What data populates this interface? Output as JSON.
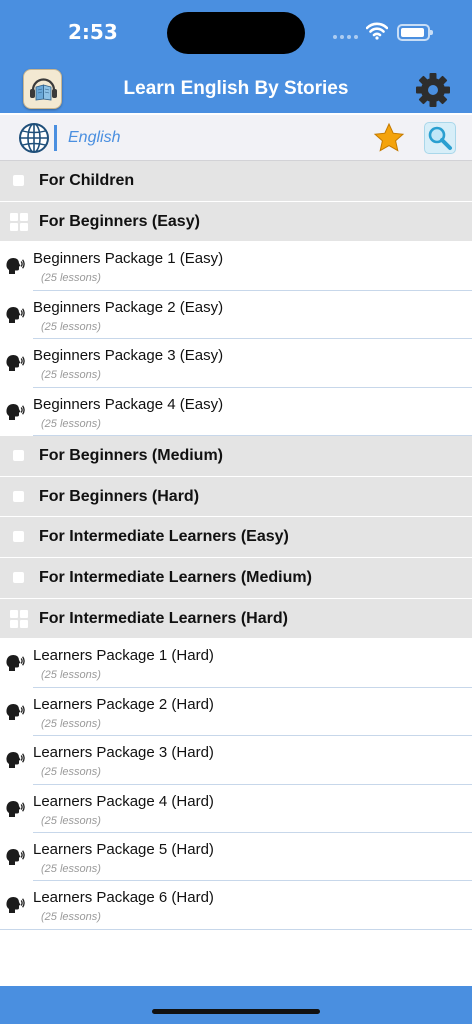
{
  "status": {
    "time": "2:53"
  },
  "header": {
    "title": "Learn English By Stories",
    "logo_icon": "book-headphones-icon",
    "settings_icon": "gear-icon"
  },
  "toolbar": {
    "language": "English",
    "globe_icon": "globe-icon",
    "favorites_icon": "star-icon",
    "search_icon": "search-icon"
  },
  "colors": {
    "accent": "#4a8fe0",
    "section_bg": "#e4e4e4",
    "star": "#f4a30c"
  },
  "sections": [
    {
      "label": "For Children",
      "expanded": false,
      "items": []
    },
    {
      "label": "For Beginners (Easy)",
      "expanded": true,
      "items": [
        {
          "title": "Beginners Package 1 (Easy)",
          "subtitle": "(25 lessons)"
        },
        {
          "title": "Beginners Package 2 (Easy)",
          "subtitle": "(25 lessons)"
        },
        {
          "title": "Beginners Package 3 (Easy)",
          "subtitle": "(25 lessons)"
        },
        {
          "title": "Beginners Package 4 (Easy)",
          "subtitle": "(25 lessons)"
        }
      ]
    },
    {
      "label": "For Beginners (Medium)",
      "expanded": false,
      "items": []
    },
    {
      "label": "For Beginners (Hard)",
      "expanded": false,
      "items": []
    },
    {
      "label": "For Intermediate Learners (Easy)",
      "expanded": false,
      "items": []
    },
    {
      "label": "For Intermediate Learners (Medium)",
      "expanded": false,
      "items": []
    },
    {
      "label": "For Intermediate Learners (Hard)",
      "expanded": true,
      "items": [
        {
          "title": "Learners Package 1 (Hard)",
          "subtitle": "(25 lessons)"
        },
        {
          "title": "Learners Package 2 (Hard)",
          "subtitle": "(25 lessons)"
        },
        {
          "title": "Learners Package 3 (Hard)",
          "subtitle": "(25 lessons)"
        },
        {
          "title": "Learners Package 4 (Hard)",
          "subtitle": "(25 lessons)"
        },
        {
          "title": "Learners Package 5 (Hard)",
          "subtitle": "(25 lessons)"
        },
        {
          "title": "Learners Package 6 (Hard)",
          "subtitle": "(25 lessons)"
        }
      ]
    }
  ]
}
